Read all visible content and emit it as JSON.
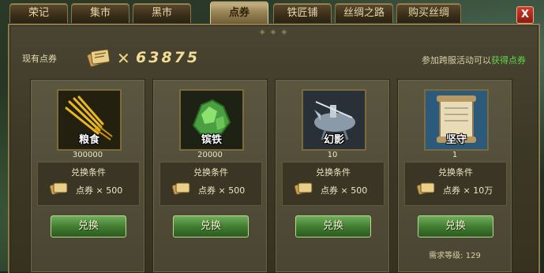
{
  "tabs": [
    {
      "label": "荣记",
      "active": false
    },
    {
      "label": "集市",
      "active": false
    },
    {
      "label": "黑市",
      "active": false
    },
    {
      "label": "点券",
      "active": true
    },
    {
      "label": "铁匠铺",
      "active": false
    },
    {
      "label": "丝绸之路",
      "active": false
    },
    {
      "label": "购买丝绸",
      "active": false
    }
  ],
  "close_label": "X",
  "coupon": {
    "label": "现有点券",
    "x_mark": "✕",
    "amount": "63875"
  },
  "event": {
    "text": "参加跨服活动可以",
    "link": "获得点券"
  },
  "cards": [
    {
      "item_name": "粮食",
      "item_icon": "grain-icon",
      "quantity": "300000",
      "condition_title": "兑换条件",
      "cost": "点券 × 500",
      "button": "兑换",
      "required_level": ""
    },
    {
      "item_name": "镔铁",
      "item_icon": "iron-ore-icon",
      "quantity": "20000",
      "condition_title": "兑换条件",
      "cost": "点券 × 500",
      "button": "兑换",
      "required_level": ""
    },
    {
      "item_name": "幻影",
      "item_icon": "phantom-horse-icon",
      "quantity": "10",
      "condition_title": "兑换条件",
      "cost": "点券 × 500",
      "button": "兑换",
      "required_level": ""
    },
    {
      "item_name": "坚守",
      "item_icon": "scroll-icon",
      "quantity": "1",
      "condition_title": "兑换条件",
      "cost": "点券 × 10万",
      "button": "兑换",
      "required_level": "需求等级: 129"
    }
  ],
  "colors": {
    "accent_gold": "#f3dc96",
    "link_green": "#5fd84a",
    "button_green": "#3f7a30",
    "close_red": "#d23a2a"
  }
}
